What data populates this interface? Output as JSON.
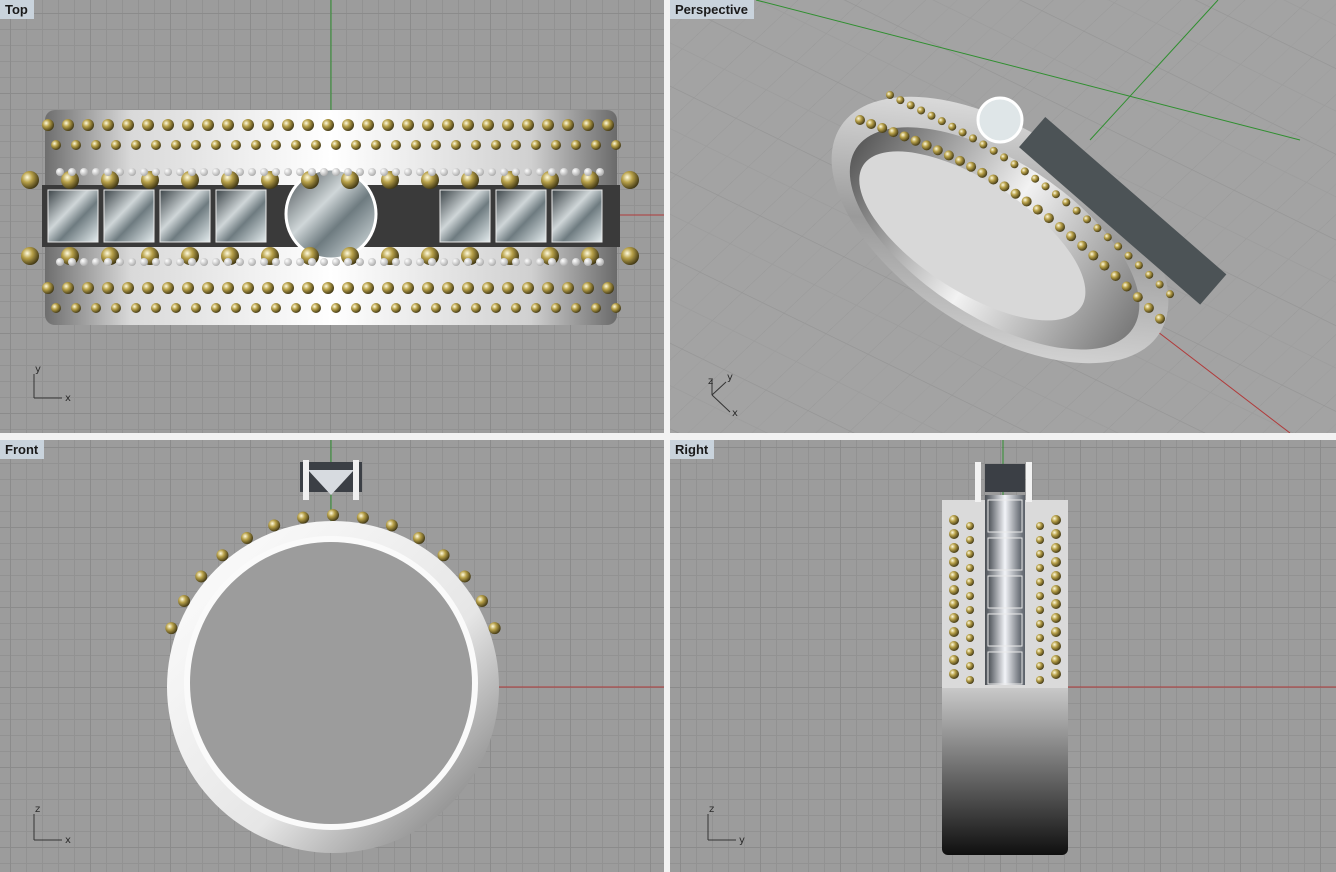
{
  "viewports": {
    "top": {
      "label": "Top",
      "axis_h": "x",
      "axis_v": "y"
    },
    "perspective": {
      "label": "Perspective",
      "axis_a": "z",
      "axis_b": "y",
      "axis_c": "x"
    },
    "front": {
      "label": "Front",
      "axis_h": "x",
      "axis_v": "z"
    },
    "right": {
      "label": "Right",
      "axis_h": "y",
      "axis_v": "z"
    }
  },
  "colors": {
    "viewport_bg": "#9c9c9c",
    "grid_major": "#8b8b8b",
    "grid_minor": "#929292",
    "x_axis": "#b13a3a",
    "y_axis": "#2f8f2f",
    "metal_white": "#f2f2f2",
    "metal_gold": "#9a8a3a",
    "label_bg": "#c9d3dc"
  }
}
